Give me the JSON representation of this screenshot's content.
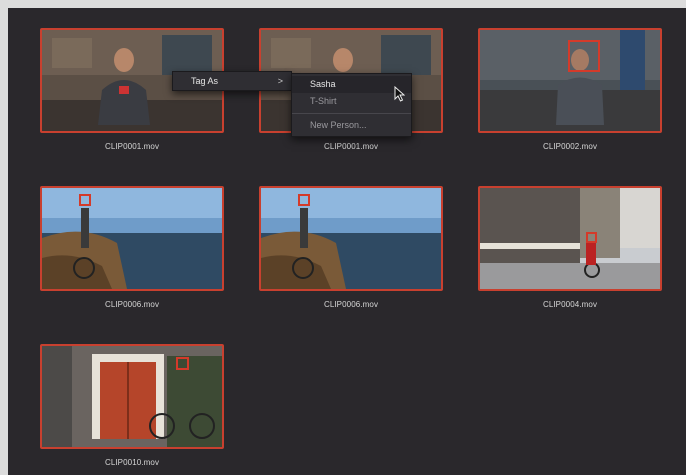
{
  "clips": [
    {
      "name": "CLIP0001.mov",
      "scene": "interview-workshop"
    },
    {
      "name": "CLIP0001.mov",
      "scene": "interview-workshop"
    },
    {
      "name": "CLIP0002.mov",
      "scene": "cafe-man"
    },
    {
      "name": "CLIP0006.mov",
      "scene": "cyclist-coast"
    },
    {
      "name": "CLIP0006.mov",
      "scene": "cyclist-coast"
    },
    {
      "name": "CLIP0004.mov",
      "scene": "city-street-cyclist"
    },
    {
      "name": "CLIP0010.mov",
      "scene": "red-door-cyclist"
    }
  ],
  "context_menu": {
    "tag_as_label": "Tag As",
    "submenu_arrow": ">",
    "submenu": {
      "sasha": "Sasha",
      "tshirt": "T-Shirt",
      "new_person": "New Person..."
    }
  },
  "colors": {
    "background": "#2a282c",
    "clip_border": "#c8402f",
    "face_box": "#d43a2a"
  },
  "icons": {
    "cursor": "mouse-pointer-icon",
    "submenu": "chevron-right-icon"
  }
}
